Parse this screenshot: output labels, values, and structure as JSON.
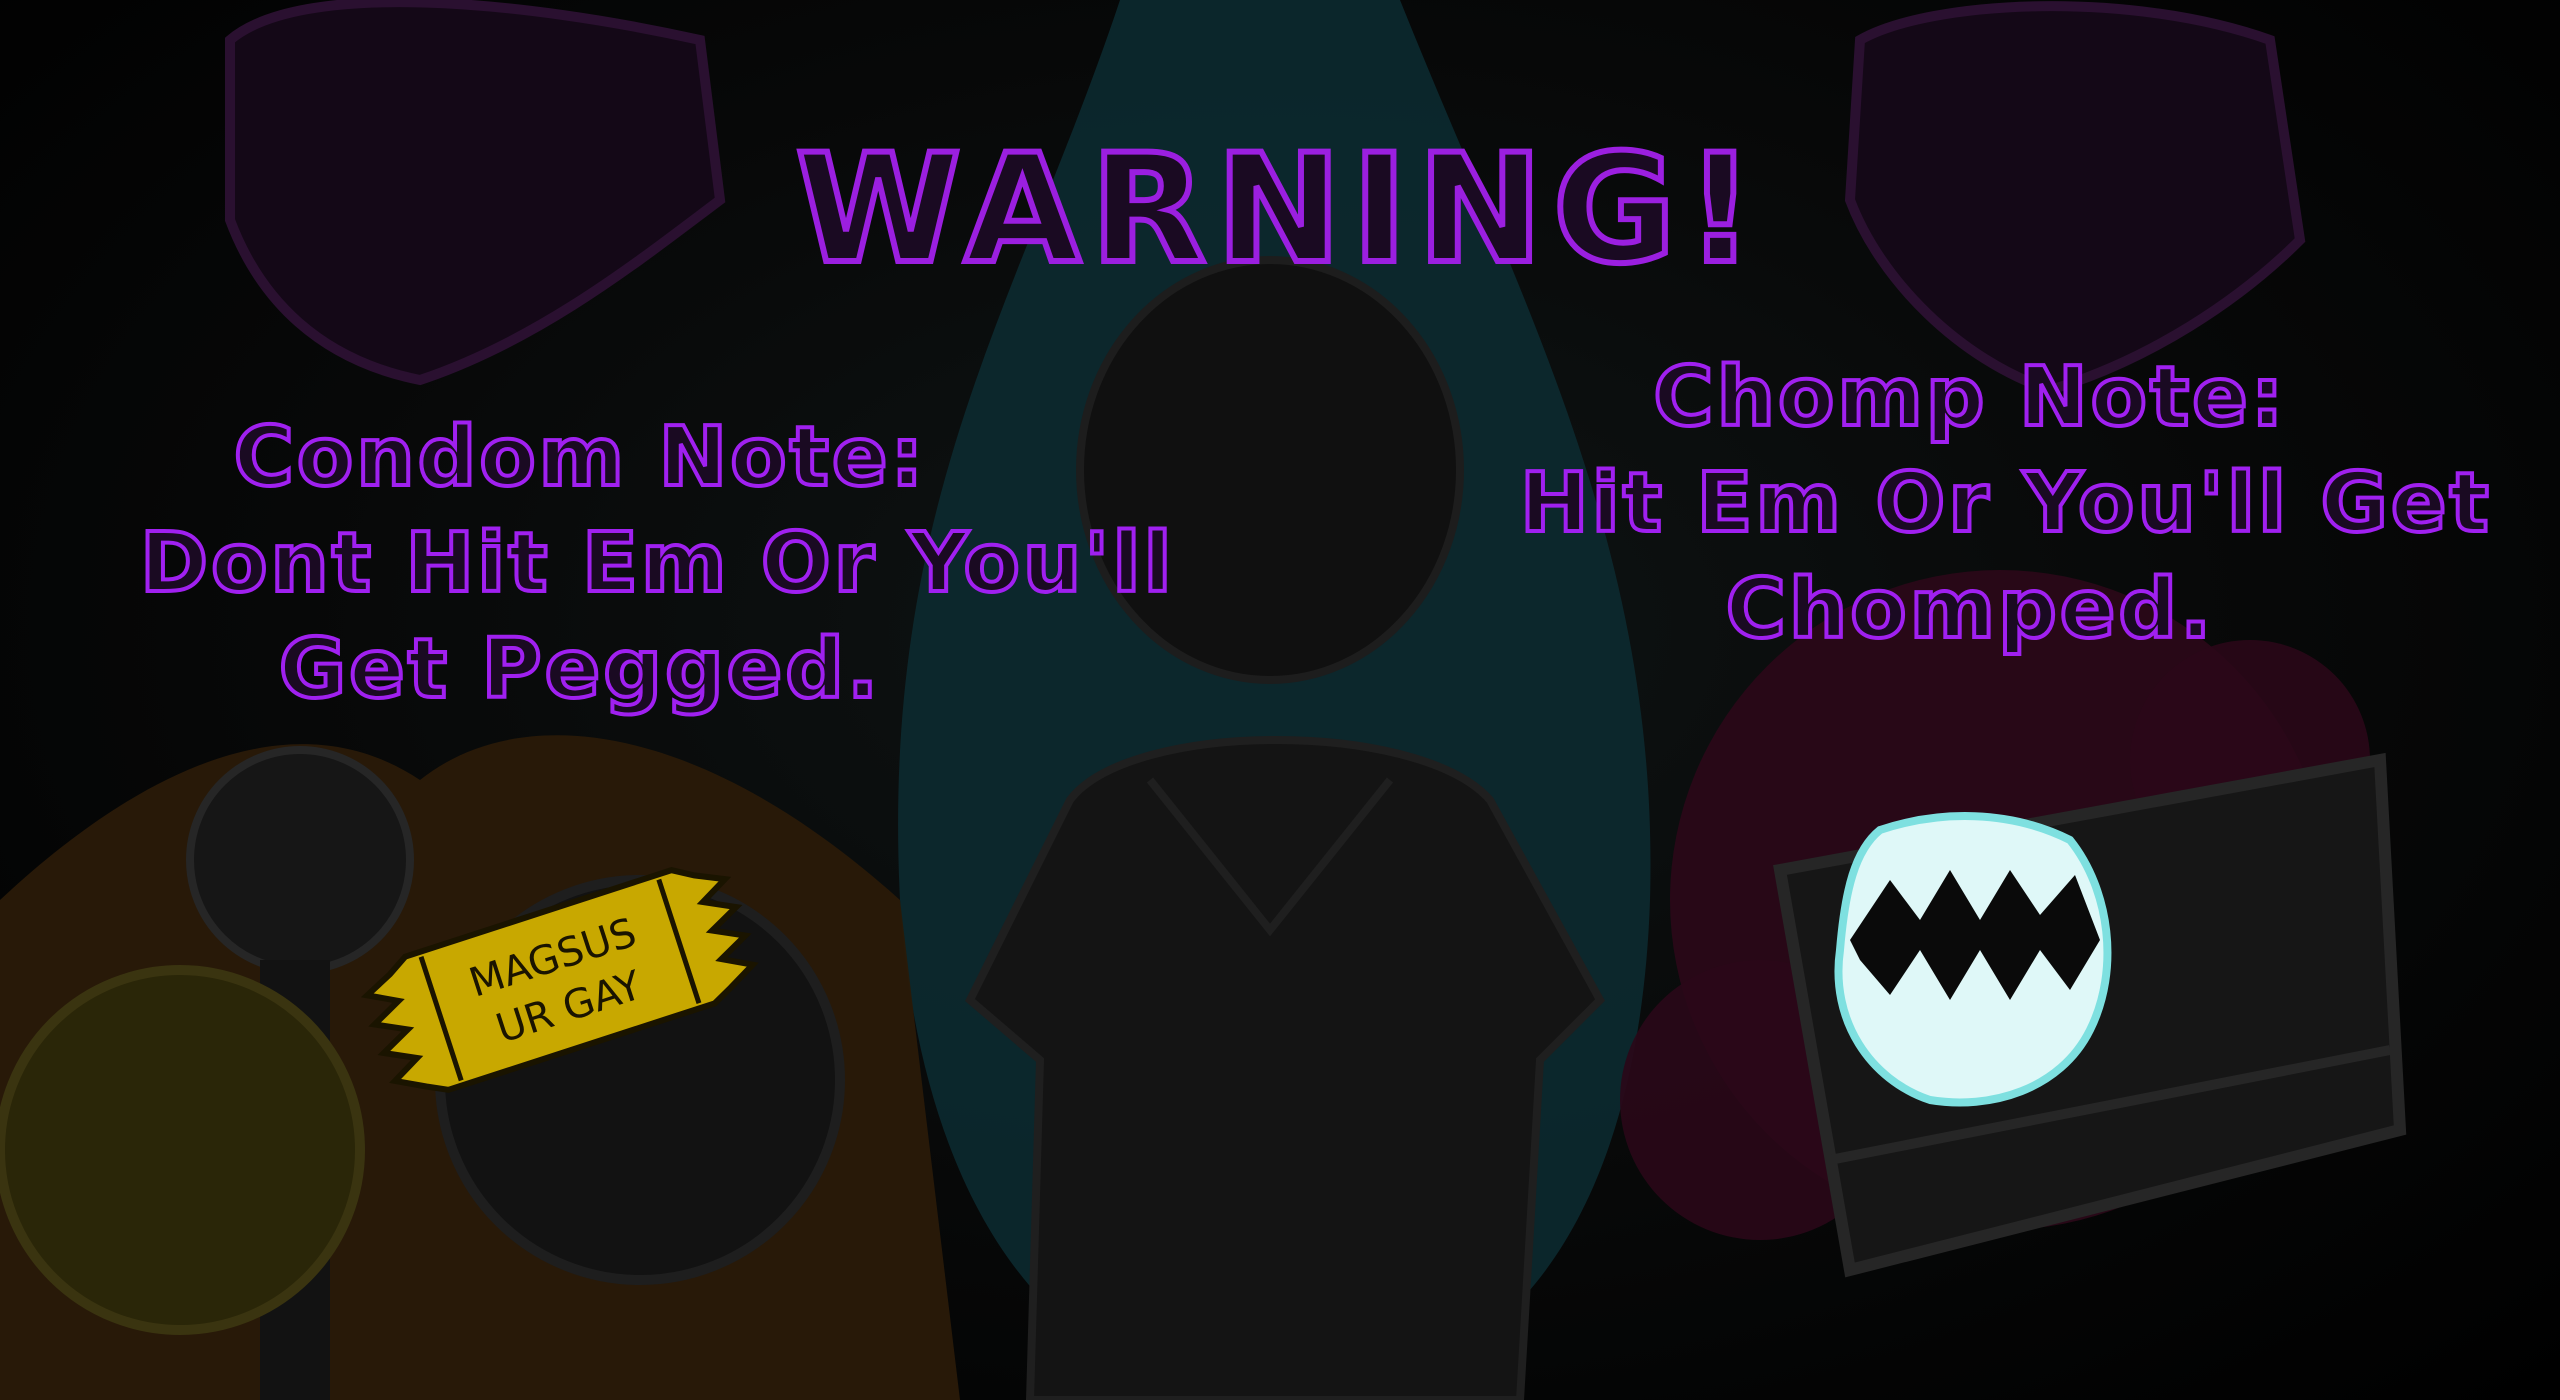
{
  "title": "WARNING!",
  "condom_note": {
    "line1": "Condom Note:",
    "line2": "Dont Hit Em Or You'll",
    "line3": "Get Pegged.",
    "sticker_line1": "MAGSUS",
    "sticker_line2": "UR GAY",
    "sticker_color": "#c8a800"
  },
  "chomp_note": {
    "line1": "Chomp Note:",
    "line2": "Hit Em Or You'll Get",
    "line3": "Chomped.",
    "icon": "chomp-teeth-icon",
    "icon_color": "#dff8f8"
  },
  "colors": {
    "text_outline": "#a020f0",
    "background": "#000000"
  }
}
